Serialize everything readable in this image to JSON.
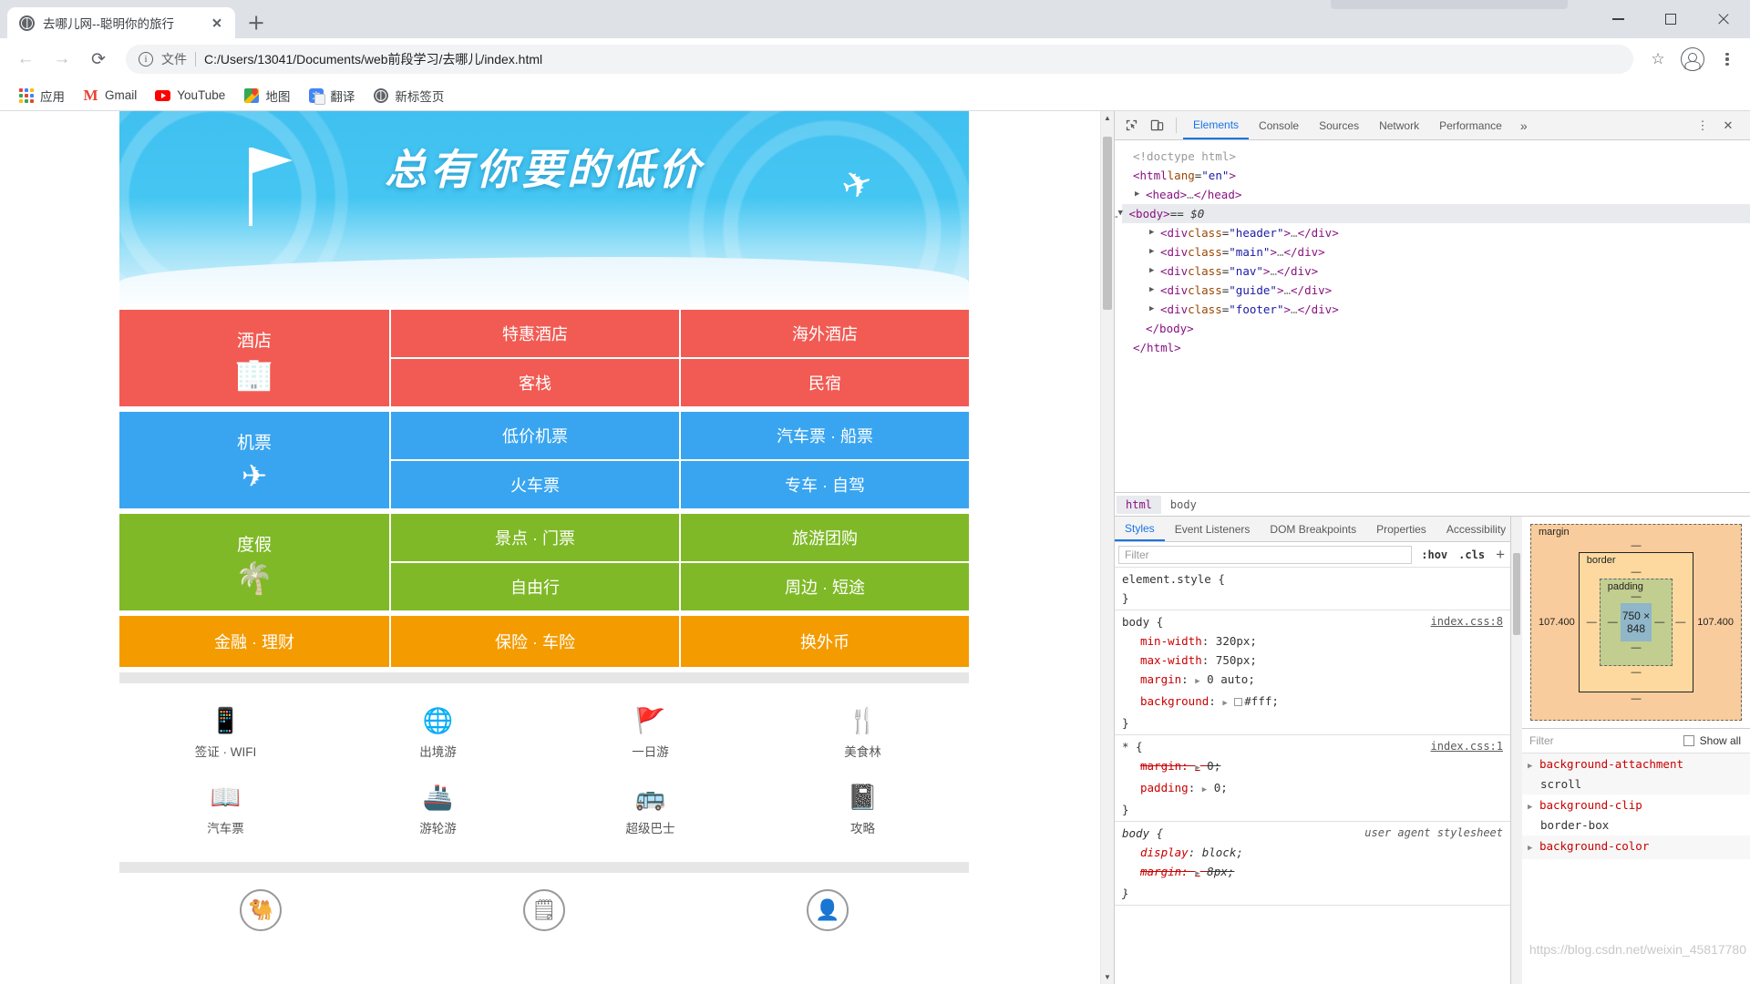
{
  "browser": {
    "tab": {
      "title": "去哪儿网--聪明你的旅行",
      "favicon": "globe-icon",
      "close": "×"
    },
    "new_tab_label": "+",
    "window_controls": {
      "minimize": "—",
      "maximize": "□",
      "close": "×"
    },
    "nav": {
      "back": "←",
      "forward": "→",
      "reload": "⟳"
    },
    "omnibox": {
      "info_icon": "i",
      "file_label": "文件",
      "url": "C:/Users/13041/Documents/web前段学习/去哪儿/index.html",
      "star_icon": "☆"
    },
    "profile_icon": "account-icon",
    "menu_icon": "kebab-menu-icon",
    "bookmarks": [
      {
        "label": "应用",
        "icon": "apps-grid-icon"
      },
      {
        "label": "Gmail",
        "icon": "gmail-icon"
      },
      {
        "label": "YouTube",
        "icon": "youtube-icon"
      },
      {
        "label": "地图",
        "icon": "google-maps-icon"
      },
      {
        "label": "翻译",
        "icon": "google-translate-icon"
      },
      {
        "label": "新标签页",
        "icon": "new-tab-globe-icon"
      }
    ]
  },
  "page": {
    "banner": {
      "title": "总有你要的低价",
      "flag": "flag-icon",
      "plane": "✈"
    },
    "nav_tiles": [
      {
        "color": "#f15b53",
        "main": {
          "label": "酒店",
          "icon": "🏢"
        },
        "sub_rows": [
          [
            "特惠酒店",
            "海外酒店"
          ],
          [
            "客栈",
            "民宿"
          ]
        ]
      },
      {
        "color": "#39a5f0",
        "main": {
          "label": "机票",
          "icon": "✈"
        },
        "sub_rows": [
          [
            "低价机票",
            "汽车票 · 船票"
          ],
          [
            "火车票",
            "专车 · 自驾"
          ]
        ]
      },
      {
        "color": "#7fb927",
        "main": {
          "label": "度假",
          "icon": "🌴"
        },
        "sub_rows": [
          [
            "景点 · 门票",
            "旅游团购"
          ],
          [
            "自由行",
            "周边 · 短途"
          ]
        ]
      }
    ],
    "nav_single_row": {
      "color": "#f49b00",
      "cells": [
        "金融 · 理财",
        "保险 · 车险",
        "换外币"
      ]
    },
    "icon_grid": [
      [
        {
          "label": "签证 · WIFI",
          "icon": "📱"
        },
        {
          "label": "出境游",
          "icon": "🌐"
        },
        {
          "label": "一日游",
          "icon": "🚩"
        },
        {
          "label": "美食林",
          "icon": "🍴"
        }
      ],
      [
        {
          "label": "汽车票",
          "icon": "📖"
        },
        {
          "label": "游轮游",
          "icon": "🚢"
        },
        {
          "label": "超级巴士",
          "icon": "🚌"
        },
        {
          "label": "攻略",
          "icon": "📓"
        }
      ]
    ],
    "circle_row": [
      {
        "icon": "🐫",
        "name": "camel-icon"
      },
      {
        "icon": "🗒",
        "name": "note-icon"
      },
      {
        "icon": "👤",
        "name": "person-icon"
      }
    ]
  },
  "devtools": {
    "toolbar_icons": [
      {
        "name": "inspect-element-icon",
        "glyph": "⬚"
      },
      {
        "name": "device-toolbar-icon",
        "glyph": "▭"
      }
    ],
    "tabs": [
      "Elements",
      "Console",
      "Sources",
      "Network",
      "Performance"
    ],
    "active_tab": "Elements",
    "more_tabs": "»",
    "settings_icon": "⋮",
    "close_icon": "✕",
    "dom": [
      {
        "indent": 0,
        "tri": "",
        "html": "<span class=\"tc\">&lt;!doctype html&gt;</span>"
      },
      {
        "indent": 0,
        "tri": "",
        "html": "<span class=\"tk\">&lt;html</span> <span class=\"ta\">lang</span>=<span class=\"tv\">\"en\"</span><span class=\"tk\">&gt;</span>"
      },
      {
        "indent": 1,
        "tri": "▶",
        "html": "<span class=\"tk\">&lt;head&gt;</span><span class=\"tp\">…</span><span class=\"tk\">&lt;/head&gt;</span>"
      },
      {
        "indent": 1,
        "tri": "▼",
        "html": "<span class=\"tk\">&lt;body&gt;</span> <span class=\"dollar\">== $0</span>",
        "selected": true,
        "dots": "…"
      },
      {
        "indent": 2,
        "tri": "▶",
        "html": "<span class=\"tk\">&lt;div</span> <span class=\"ta\">class</span>=<span class=\"tv\">\"header\"</span><span class=\"tk\">&gt;</span><span class=\"tp\">…</span><span class=\"tk\">&lt;/div&gt;</span>"
      },
      {
        "indent": 2,
        "tri": "▶",
        "html": "<span class=\"tk\">&lt;div</span> <span class=\"ta\">class</span>=<span class=\"tv\">\"main\"</span><span class=\"tk\">&gt;</span><span class=\"tp\">…</span><span class=\"tk\">&lt;/div&gt;</span>"
      },
      {
        "indent": 2,
        "tri": "▶",
        "html": "<span class=\"tk\">&lt;div</span> <span class=\"ta\">class</span>=<span class=\"tv\">\"nav\"</span><span class=\"tk\">&gt;</span><span class=\"tp\">…</span><span class=\"tk\">&lt;/div&gt;</span>"
      },
      {
        "indent": 2,
        "tri": "▶",
        "html": "<span class=\"tk\">&lt;div</span> <span class=\"ta\">class</span>=<span class=\"tv\">\"guide\"</span><span class=\"tk\">&gt;</span><span class=\"tp\">…</span><span class=\"tk\">&lt;/div&gt;</span>"
      },
      {
        "indent": 2,
        "tri": "▶",
        "html": "<span class=\"tk\">&lt;div</span> <span class=\"ta\">class</span>=<span class=\"tv\">\"footer\"</span><span class=\"tk\">&gt;</span><span class=\"tp\">…</span><span class=\"tk\">&lt;/div&gt;</span>"
      },
      {
        "indent": 1,
        "tri": "",
        "html": "<span class=\"tk\">&lt;/body&gt;</span>"
      },
      {
        "indent": 0,
        "tri": "",
        "html": "<span class=\"tk\">&lt;/html&gt;</span>"
      }
    ],
    "breadcrumbs": [
      {
        "label": "html",
        "active": true
      },
      {
        "label": "body",
        "active": false
      }
    ],
    "styles_tabs": [
      "Styles",
      "Event Listeners",
      "DOM Breakpoints",
      "Properties",
      "Accessibility"
    ],
    "styles_active": "Styles",
    "filter_placeholder": "Filter",
    "hov_label": ":hov",
    "cls_label": ".cls",
    "plus_label": "+",
    "css_rules": [
      {
        "selector": "element.style {",
        "source": "",
        "props": [],
        "close": "}"
      },
      {
        "selector": "body {",
        "source": "index.css:8",
        "props": [
          {
            "name": "min-width",
            "value": "320px;",
            "struck": false,
            "expand": false
          },
          {
            "name": "max-width",
            "value": "750px;",
            "struck": false,
            "expand": false
          },
          {
            "name": "margin",
            "value": "0 auto;",
            "struck": false,
            "expand": true
          },
          {
            "name": "background",
            "value": "#fff;",
            "struck": false,
            "expand": true,
            "swatch": "#ffffff"
          }
        ],
        "close": "}"
      },
      {
        "selector": "* {",
        "source": "index.css:1",
        "props": [
          {
            "name": "margin",
            "value": "0;",
            "struck": true,
            "expand": true
          },
          {
            "name": "padding",
            "value": "0;",
            "struck": false,
            "expand": true
          }
        ],
        "close": "}"
      },
      {
        "selector": "body {",
        "source": "user agent stylesheet",
        "ua": true,
        "props": [
          {
            "name": "display",
            "value": "block;",
            "struck": false,
            "expand": false
          },
          {
            "name": "margin",
            "value": "8px;",
            "struck": true,
            "expand": true
          }
        ],
        "close": "}"
      }
    ],
    "box_model": {
      "margin_label": "margin",
      "border_label": "border",
      "padding_label": "padding",
      "content": "750 × 848",
      "margin_left": "107.400",
      "margin_right": "107.400",
      "dash": "—"
    },
    "computed": {
      "filter_placeholder": "Filter",
      "show_all_label": "Show all",
      "properties": [
        {
          "name": "background-attachment",
          "value": "scroll"
        },
        {
          "name": "background-clip",
          "value": "border-box"
        },
        {
          "name": "background-color",
          "value": ""
        }
      ]
    },
    "watermark": "https://blog.csdn.net/weixin_45817780"
  }
}
